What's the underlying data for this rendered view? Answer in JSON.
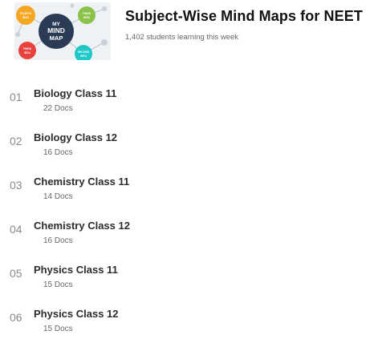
{
  "course": {
    "title": "Subject-Wise Mind Maps for NEET",
    "learners": "1,402 students learning this week",
    "thumbnail": {
      "center_line1": "MY",
      "center_line2": "MIND",
      "center_line3": "MAP",
      "bubble_fourth_line1": "FOURTH",
      "bubble_fourth_line2": "IDEA",
      "bubble_third_line1": "THIRD",
      "bubble_third_line2": "IDEA",
      "bubble_first_line1": "THIRD",
      "bubble_first_line2": "IDEA",
      "bubble_second_line1": "SECOND",
      "bubble_second_line2": "IDEA"
    }
  },
  "modules": [
    {
      "index": "01",
      "name": "Biology Class 11",
      "docs": "22 Docs"
    },
    {
      "index": "02",
      "name": "Biology Class 12",
      "docs": "16 Docs"
    },
    {
      "index": "03",
      "name": "Chemistry Class 11",
      "docs": "14 Docs"
    },
    {
      "index": "04",
      "name": "Chemistry Class 12",
      "docs": "16 Docs"
    },
    {
      "index": "05",
      "name": "Physics Class 11",
      "docs": "15 Docs"
    },
    {
      "index": "06",
      "name": "Physics Class 12",
      "docs": "15 Docs"
    }
  ],
  "colors": {
    "bubble_orange": "#f5a623",
    "bubble_green": "#8bc34a",
    "bubble_red": "#e8413b",
    "bubble_cyan": "#1ec8c8",
    "center_navy": "#2b3a55"
  }
}
